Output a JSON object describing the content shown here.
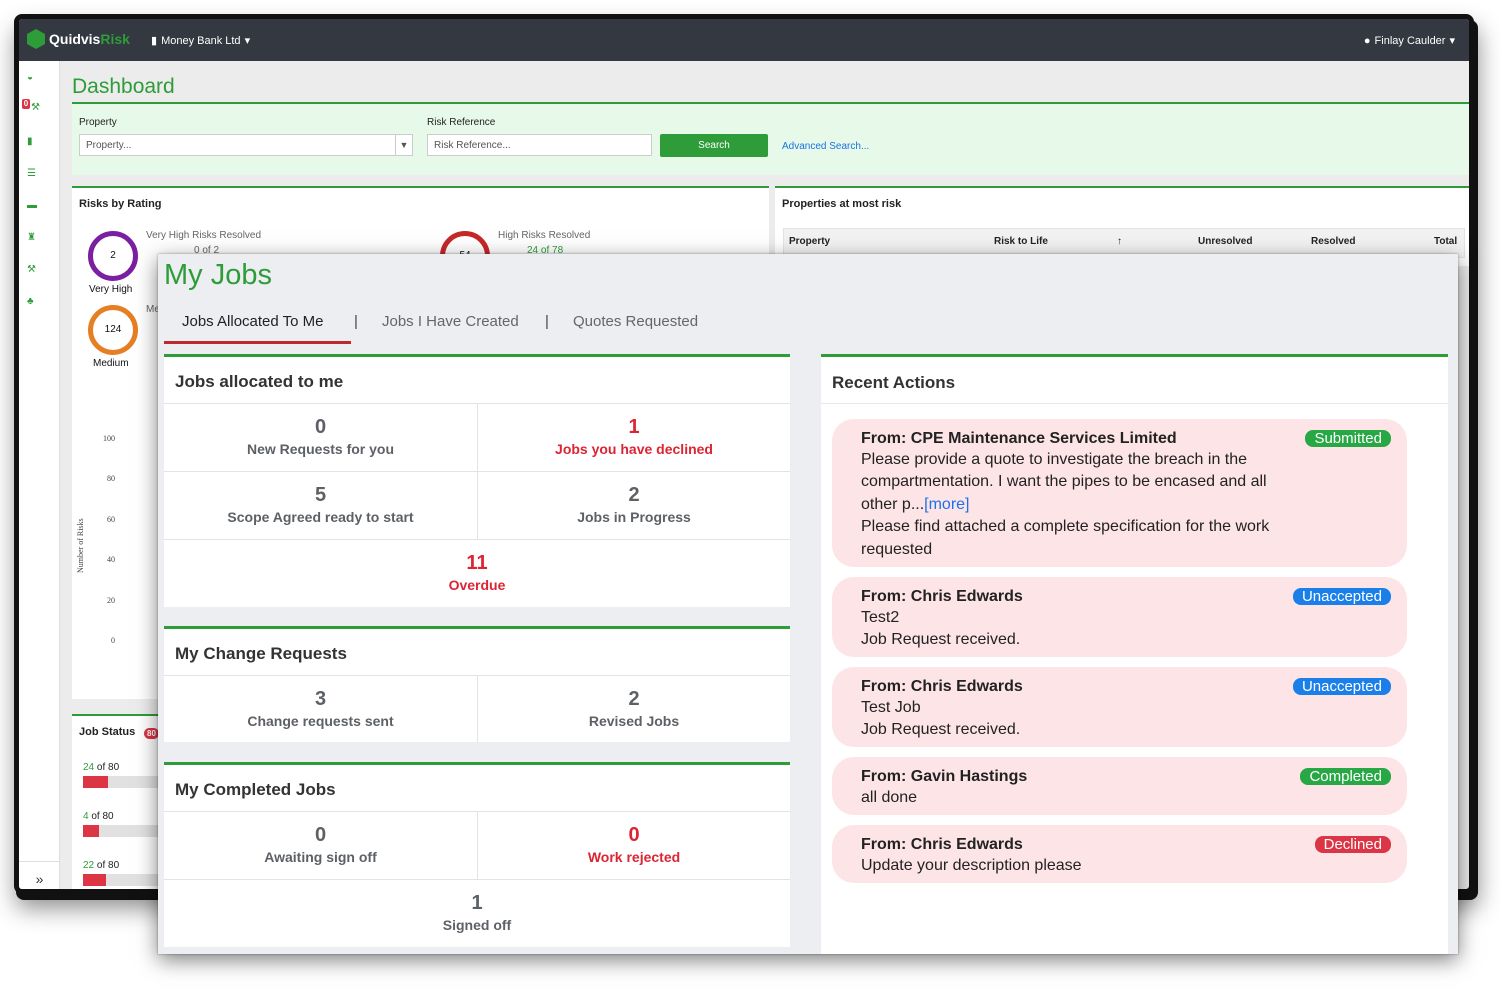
{
  "dashboard": {
    "logo": {
      "brand": "Quidvis",
      "brand_accent": "Risk"
    },
    "org": "Money Bank Ltd",
    "user": "Finlay Caulder",
    "sidebar_badge": "0",
    "title": "Dashboard",
    "filter": {
      "property_label": "Property",
      "property_placeholder": "Property...",
      "risk_ref_label": "Risk Reference",
      "risk_ref_placeholder": "Risk Reference...",
      "search_label": "Search",
      "advanced_label": "Advanced Search..."
    },
    "risks_by_rating": {
      "title": "Risks by Rating",
      "very_high": {
        "value": "2",
        "label": "Very High",
        "meta": "Very High Risks Resolved",
        "resolved": "0 of 2"
      },
      "high": {
        "value": "54",
        "meta": "High Risks Resolved",
        "resolved": "24 of 78"
      },
      "medium": {
        "value": "124",
        "label": "Medium",
        "meta_short": "Me"
      },
      "y_axis_label": "Number of Risks",
      "y_ticks": [
        "100",
        "80",
        "60",
        "40",
        "20",
        "0"
      ]
    },
    "properties_at_risk": {
      "title": "Properties at most risk",
      "columns": [
        "Property",
        "Risk to Life",
        "↑",
        "Unresolved",
        "Resolved",
        "Total"
      ]
    },
    "job_status": {
      "title": "Job Status",
      "badge": "80",
      "bars": [
        {
          "done": "24",
          "text": " of 80",
          "fraction": 0.3
        },
        {
          "done": "4",
          "text": " of 80",
          "fraction": 0.2
        },
        {
          "done": "22",
          "text": " of 80",
          "fraction": 0.28
        }
      ]
    }
  },
  "my_jobs": {
    "title": "My Jobs",
    "tabs": [
      "Jobs Allocated To Me",
      "Jobs I Have Created",
      "Quotes Requested"
    ],
    "allocated": {
      "title": "Jobs allocated to me",
      "stats": [
        {
          "number": "0",
          "label": "New Requests for you"
        },
        {
          "number": "1",
          "label": "Jobs you have declined"
        },
        {
          "number": "5",
          "label": "Scope Agreed ready to start"
        },
        {
          "number": "2",
          "label": "Jobs in Progress"
        },
        {
          "number": "11",
          "label": "Overdue"
        }
      ]
    },
    "change_requests": {
      "title": "My Change Requests",
      "stats": [
        {
          "number": "3",
          "label": "Change requests sent"
        },
        {
          "number": "2",
          "label": "Revised Jobs"
        }
      ]
    },
    "completed": {
      "title": "My Completed Jobs",
      "stats": [
        {
          "number": "0",
          "label": "Awaiting sign off"
        },
        {
          "number": "0",
          "label": "Work rejected"
        },
        {
          "number": "1",
          "label": "Signed off"
        }
      ]
    },
    "recent_actions": {
      "title": "Recent Actions",
      "items": [
        {
          "from": "From: CPE Maintenance Services Limited",
          "status": "Submitted",
          "lines": [
            "Please provide a quote to investigate the breach in the",
            "compartmentation. I want the pipes to be encased and all",
            "other p..."
          ],
          "more": "[more]",
          "extra": [
            "Please find attached a complete specification for the work",
            "requested"
          ]
        },
        {
          "from": "From: Chris Edwards",
          "status": "Unaccepted",
          "lines": [
            "Test2",
            "Job Request received."
          ]
        },
        {
          "from": "From: Chris Edwards",
          "status": "Unaccepted",
          "lines": [
            "Test Job",
            "Job Request received."
          ]
        },
        {
          "from": "From: Gavin Hastings",
          "status": "Completed",
          "lines": [
            "all done"
          ]
        },
        {
          "from": "From: Chris Edwards",
          "status": "Declined",
          "lines": [
            "Update your description please"
          ]
        }
      ]
    }
  },
  "colors": {
    "brand_green": "#2e9c39",
    "danger": "#dc2433",
    "submitted": "#28a745",
    "unaccepted": "#1a7fe8",
    "completed": "#28a745",
    "declined": "#dc3545"
  }
}
